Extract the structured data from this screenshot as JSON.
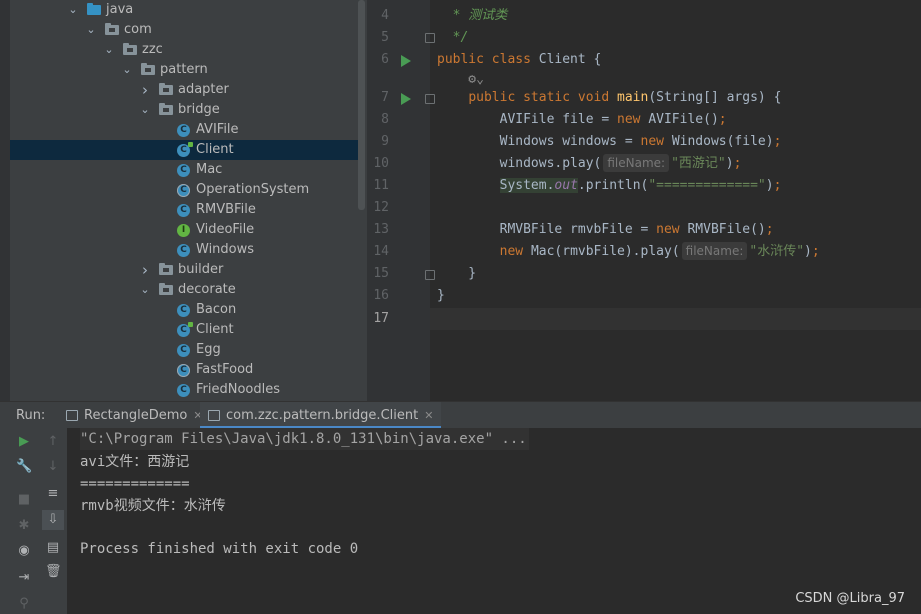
{
  "tree": {
    "rows": [
      {
        "label": "java",
        "kind": "folder-blue",
        "depth": 0,
        "expanded": true
      },
      {
        "label": "com",
        "kind": "package",
        "depth": 1,
        "expanded": true
      },
      {
        "label": "zzc",
        "kind": "package",
        "depth": 2,
        "expanded": true
      },
      {
        "label": "pattern",
        "kind": "package",
        "depth": 3,
        "expanded": true
      },
      {
        "label": "adapter",
        "kind": "package",
        "depth": 4,
        "expanded": false
      },
      {
        "label": "bridge",
        "kind": "package",
        "depth": 4,
        "expanded": true
      },
      {
        "label": "AVIFile",
        "kind": "class",
        "depth": 5
      },
      {
        "label": "Client",
        "kind": "class-run",
        "depth": 5,
        "selected": true
      },
      {
        "label": "Mac",
        "kind": "class",
        "depth": 5
      },
      {
        "label": "OperationSystem",
        "kind": "abstract",
        "depth": 5
      },
      {
        "label": "RMVBFile",
        "kind": "class",
        "depth": 5
      },
      {
        "label": "VideoFile",
        "kind": "interface",
        "depth": 5
      },
      {
        "label": "Windows",
        "kind": "class",
        "depth": 5
      },
      {
        "label": "builder",
        "kind": "package",
        "depth": 4,
        "expanded": false
      },
      {
        "label": "decorate",
        "kind": "package",
        "depth": 4,
        "expanded": true
      },
      {
        "label": "Bacon",
        "kind": "class",
        "depth": 5
      },
      {
        "label": "Client",
        "kind": "class-run",
        "depth": 5
      },
      {
        "label": "Egg",
        "kind": "class",
        "depth": 5
      },
      {
        "label": "FastFood",
        "kind": "abstract",
        "depth": 5
      },
      {
        "label": "FriedNoodles",
        "kind": "class",
        "depth": 5
      }
    ]
  },
  "editor": {
    "lines": [
      {
        "num": "4",
        "text": "  * 测试类"
      },
      {
        "num": "5",
        "text": "  */"
      },
      {
        "num": "6",
        "text": "public class Client {"
      },
      {
        "num": "",
        "text": "    ⚙︎⌄"
      },
      {
        "num": "7",
        "text": "    public static void main(String[] args) {"
      },
      {
        "num": "8",
        "text": "        AVIFile file = new AVIFile();"
      },
      {
        "num": "9",
        "text": "        Windows windows = new Windows(file);"
      },
      {
        "num": "10",
        "text": "        windows.play( fileName: \"西游记\");"
      },
      {
        "num": "11",
        "text": "        System.out.println(\"=============\");"
      },
      {
        "num": "12",
        "text": ""
      },
      {
        "num": "13",
        "text": "        RMVBFile rmvbFile = new RMVBFile();"
      },
      {
        "num": "14",
        "text": "        new Mac(rmvbFile).play( fileName: \"水浒传\");"
      },
      {
        "num": "15",
        "text": "    }"
      },
      {
        "num": "16",
        "text": "}"
      },
      {
        "num": "17",
        "text": ""
      }
    ],
    "param_hint": "fileName:",
    "current_line": "17"
  },
  "run": {
    "label": "Run:",
    "tabs": [
      {
        "label": "RectangleDemo",
        "active": false
      },
      {
        "label": "com.zzc.pattern.bridge.Client",
        "active": true
      }
    ],
    "console": [
      "\"C:\\Program Files\\Java\\jdk1.8.0_131\\bin\\java.exe\" ...",
      "avi文件：西游记",
      "=============",
      "rmvb视频文件：水浒传",
      "",
      "Process finished with exit code 0"
    ]
  },
  "watermark": "CSDN @Libra_97",
  "colors": {
    "selection": "#0d293e",
    "keyword": "#cc7832",
    "string": "#6a8759",
    "comment": "#629755",
    "run": "#499c54"
  }
}
